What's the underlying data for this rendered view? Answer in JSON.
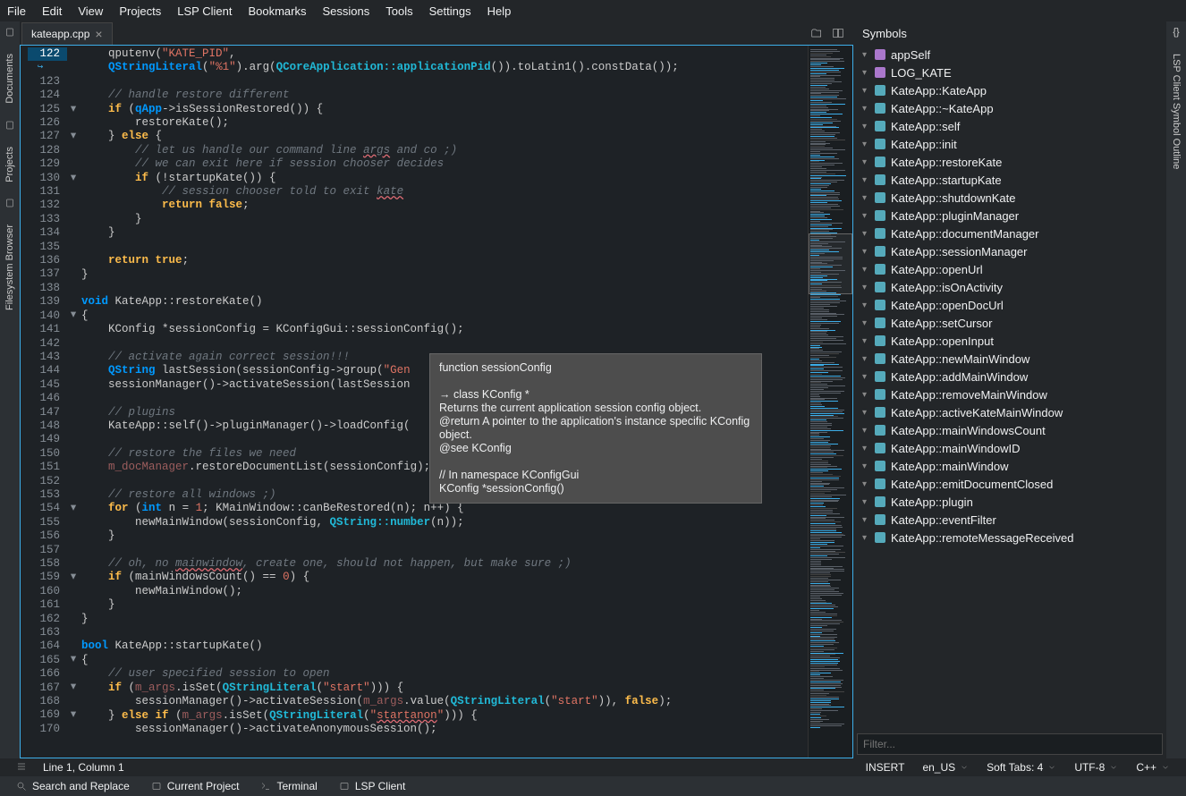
{
  "menu": [
    "File",
    "Edit",
    "View",
    "Projects",
    "LSP Client",
    "Bookmarks",
    "Sessions",
    "Tools",
    "Settings",
    "Help"
  ],
  "left_dock": [
    {
      "label": "Documents",
      "icon": "document-icon"
    },
    {
      "label": "Projects",
      "icon": "project-icon"
    },
    {
      "label": "Filesystem Browser",
      "icon": "folder-icon"
    }
  ],
  "right_dock": [
    {
      "label": "LSP Client Symbol Outline",
      "icon": "braces-icon"
    }
  ],
  "tab": {
    "name": "kateapp.cpp"
  },
  "tabbar_icons": [
    "folder-open-icon",
    "split-icon"
  ],
  "code_lines": [
    {
      "n": 122,
      "fold": "",
      "html": "    qputenv(<span class='str'>\"KATE_PID\"</span>,"
    },
    {
      "n": "↪",
      "fold": "",
      "html": "    <span class='type'>QStringLiteral</span>(<span class='str'>\"%1\"</span>).arg(<span class='const'>QCoreApplication</span><span class='const'>::</span><span class='const'>applicationPid</span>()).toLatin1().constData());",
      "cls": "gut-mark"
    },
    {
      "n": 123,
      "fold": "",
      "html": ""
    },
    {
      "n": 124,
      "fold": "",
      "html": "    <span class='com'>// handle restore different</span>"
    },
    {
      "n": 125,
      "fold": "▾",
      "html": "    <span class='kw'>if</span> (<span class='type'>qApp</span>->isSessionRestored()) {"
    },
    {
      "n": 126,
      "fold": "",
      "html": "        restoreKate();"
    },
    {
      "n": 127,
      "fold": "▾",
      "html": "    } <span class='kw'>else</span> {"
    },
    {
      "n": 128,
      "fold": "",
      "html": "        <span class='com'>// let us handle our command line <span class='underline-err'>args</span> and co ;)</span>"
    },
    {
      "n": 129,
      "fold": "",
      "html": "        <span class='com'>// we can exit here if session chooser decides</span>"
    },
    {
      "n": 130,
      "fold": "▾",
      "html": "        <span class='kw'>if</span> (!startupKate()) {"
    },
    {
      "n": 131,
      "fold": "",
      "html": "            <span class='com'>// session chooser told to exit <span class='underline-err'>kate</span></span>"
    },
    {
      "n": 132,
      "fold": "",
      "html": "            <span class='kw'>return</span> <span class='kw'>false</span>;"
    },
    {
      "n": 133,
      "fold": "",
      "html": "        }"
    },
    {
      "n": 134,
      "fold": "",
      "html": "    }"
    },
    {
      "n": 135,
      "fold": "",
      "html": ""
    },
    {
      "n": 136,
      "fold": "",
      "html": "    <span class='kw'>return</span> <span class='kw'>true</span>;"
    },
    {
      "n": 137,
      "fold": "",
      "html": "}"
    },
    {
      "n": 138,
      "fold": "",
      "html": ""
    },
    {
      "n": 139,
      "fold": "",
      "html": "<span class='type'>void</span> KateApp::restoreKate()"
    },
    {
      "n": 140,
      "fold": "▾",
      "html": "{"
    },
    {
      "n": 141,
      "fold": "",
      "html": "    KConfig *sessionConfig = KConfigGui::sessionConfig();"
    },
    {
      "n": 142,
      "fold": "",
      "html": ""
    },
    {
      "n": 143,
      "fold": "",
      "html": "    <span class='com'>// activate again correct session!!!</span>"
    },
    {
      "n": 144,
      "fold": "",
      "html": "    <span class='type'>QString</span> lastSession(sessionConfig->group(<span class='str'>\"Gen</span>"
    },
    {
      "n": 145,
      "fold": "",
      "html": "    sessionManager()->activateSession(lastSession"
    },
    {
      "n": 146,
      "fold": "",
      "html": ""
    },
    {
      "n": 147,
      "fold": "",
      "html": "    <span class='com'>// plugins</span>"
    },
    {
      "n": 148,
      "fold": "",
      "html": "    KateApp::self()->pluginManager()->loadConfig("
    },
    {
      "n": 149,
      "fold": "",
      "html": ""
    },
    {
      "n": 150,
      "fold": "",
      "html": "    <span class='com'>// restore the files we need</span>"
    },
    {
      "n": 151,
      "fold": "",
      "html": "    <span class='member'>m_docManager</span>.restoreDocumentList(sessionConfig);"
    },
    {
      "n": 152,
      "fold": "",
      "html": ""
    },
    {
      "n": 153,
      "fold": "",
      "html": "    <span class='com'>// restore all windows ;)</span>"
    },
    {
      "n": 154,
      "fold": "▾",
      "html": "    <span class='kw'>for</span> (<span class='type'>int</span> n = <span class='num'>1</span>; KMainWindow::canBeRestored(n); n++) {"
    },
    {
      "n": 155,
      "fold": "",
      "html": "        newMainWindow(sessionConfig, <span class='const'>QString</span><span class='const'>::</span><span class='const'>number</span>(n));"
    },
    {
      "n": 156,
      "fold": "",
      "html": "    }"
    },
    {
      "n": 157,
      "fold": "",
      "html": ""
    },
    {
      "n": 158,
      "fold": "",
      "html": "    <span class='com'>// oh, no <span class='underline-err'>mainwindow</span>, create one, should not happen, but make sure ;)</span>"
    },
    {
      "n": 159,
      "fold": "▾",
      "html": "    <span class='kw'>if</span> (mainWindowsCount() == <span class='num'>0</span>) {"
    },
    {
      "n": 160,
      "fold": "",
      "html": "        newMainWindow();"
    },
    {
      "n": 161,
      "fold": "",
      "html": "    }"
    },
    {
      "n": 162,
      "fold": "",
      "html": "}"
    },
    {
      "n": 163,
      "fold": "",
      "html": ""
    },
    {
      "n": 164,
      "fold": "",
      "html": "<span class='type'>bool</span> KateApp::startupKate()"
    },
    {
      "n": 165,
      "fold": "▾",
      "html": "{"
    },
    {
      "n": 166,
      "fold": "",
      "html": "    <span class='com'>// user specified session to open</span>"
    },
    {
      "n": 167,
      "fold": "▾",
      "html": "    <span class='kw'>if</span> (<span class='member'>m_args</span>.isSet(<span class='const'>QStringLiteral</span>(<span class='str'>\"start\"</span>))) {"
    },
    {
      "n": 168,
      "fold": "",
      "html": "        sessionManager()->activateSession(<span class='member'>m_args</span>.value(<span class='const'>QStringLiteral</span>(<span class='str'>\"start\"</span>)), <span class='kw'>false</span>);"
    },
    {
      "n": 169,
      "fold": "▾",
      "html": "    } <span class='kw'>else</span> <span class='kw'>if</span> (<span class='member'>m_args</span>.isSet(<span class='const'>QStringLiteral</span>(<span class='str'>\"<span class='underline-err'>startanon</span>\"</span>))) {"
    },
    {
      "n": 170,
      "fold": "",
      "html": "        sessionManager()->activateAnonymousSession();"
    }
  ],
  "tooltip": "function sessionConfig\n\n→ class KConfig *\nReturns the current application session config object.\n@return A pointer to the application's instance specific KConfig object.\n@see KConfig\n\n// In namespace KConfigGui\nKConfig *sessionConfig()",
  "symbols_title": "Symbols",
  "symbols": [
    {
      "label": "appSelf",
      "ico": "purple"
    },
    {
      "label": "LOG_KATE",
      "ico": "purple"
    },
    {
      "label": "KateApp::KateApp",
      "ico": "blue"
    },
    {
      "label": "KateApp::~KateApp",
      "ico": "blue"
    },
    {
      "label": "KateApp::self",
      "ico": "blue"
    },
    {
      "label": "KateApp::init",
      "ico": "blue"
    },
    {
      "label": "KateApp::restoreKate",
      "ico": "blue"
    },
    {
      "label": "KateApp::startupKate",
      "ico": "blue"
    },
    {
      "label": "KateApp::shutdownKate",
      "ico": "blue"
    },
    {
      "label": "KateApp::pluginManager",
      "ico": "blue"
    },
    {
      "label": "KateApp::documentManager",
      "ico": "blue"
    },
    {
      "label": "KateApp::sessionManager",
      "ico": "blue"
    },
    {
      "label": "KateApp::openUrl",
      "ico": "blue"
    },
    {
      "label": "KateApp::isOnActivity",
      "ico": "blue"
    },
    {
      "label": "KateApp::openDocUrl",
      "ico": "blue"
    },
    {
      "label": "KateApp::setCursor",
      "ico": "blue"
    },
    {
      "label": "KateApp::openInput",
      "ico": "blue"
    },
    {
      "label": "KateApp::newMainWindow",
      "ico": "blue"
    },
    {
      "label": "KateApp::addMainWindow",
      "ico": "blue"
    },
    {
      "label": "KateApp::removeMainWindow",
      "ico": "blue"
    },
    {
      "label": "KateApp::activeKateMainWindow",
      "ico": "blue"
    },
    {
      "label": "KateApp::mainWindowsCount",
      "ico": "blue"
    },
    {
      "label": "KateApp::mainWindowID",
      "ico": "blue"
    },
    {
      "label": "KateApp::mainWindow",
      "ico": "blue"
    },
    {
      "label": "KateApp::emitDocumentClosed",
      "ico": "blue"
    },
    {
      "label": "KateApp::plugin",
      "ico": "blue"
    },
    {
      "label": "KateApp::eventFilter",
      "ico": "blue"
    },
    {
      "label": "KateApp::remoteMessageReceived",
      "ico": "blue"
    }
  ],
  "filter_placeholder": "Filter...",
  "status": {
    "pos": "Line 1, Column 1",
    "mode": "INSERT",
    "lang": "en_US",
    "indent": "Soft Tabs: 4",
    "enc": "UTF-8",
    "filetype": "C++"
  },
  "bottom": [
    "Search and Replace",
    "Current Project",
    "Terminal",
    "LSP Client"
  ],
  "bottom_icons": [
    "search-icon",
    "folder-icon",
    "terminal-icon",
    "folder-icon"
  ]
}
